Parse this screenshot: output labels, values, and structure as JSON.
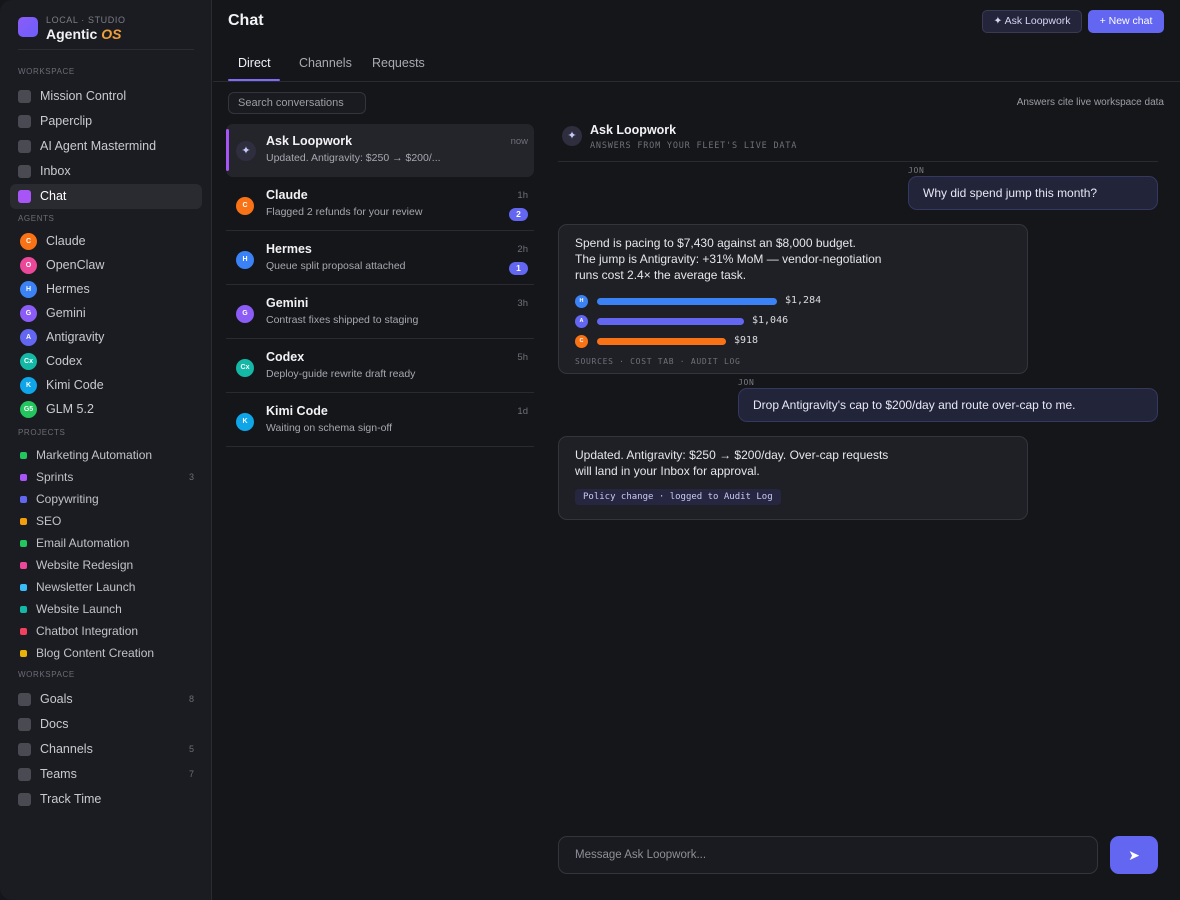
{
  "brand": {
    "sub": "LOCAL · STUDIO",
    "name": "Agentic",
    "name_accent": "OS"
  },
  "sidebar": {
    "workspace_label": "WORKSPACE",
    "workspace": [
      {
        "label": "Mission Control"
      },
      {
        "label": "Paperclip"
      },
      {
        "label": "AI Agent Mastermind"
      },
      {
        "label": "Inbox"
      },
      {
        "label": "Chat",
        "active": true
      }
    ],
    "agents_label": "AGENTS",
    "agents": [
      {
        "label": "Claude",
        "initials": "C",
        "color": "#f97316"
      },
      {
        "label": "OpenClaw",
        "initials": "O",
        "color": "#ec4899"
      },
      {
        "label": "Hermes",
        "initials": "H",
        "color": "#3b82f6"
      },
      {
        "label": "Gemini",
        "initials": "G",
        "color": "#8b5cf6"
      },
      {
        "label": "Antigravity",
        "initials": "A",
        "color": "#6366f1"
      },
      {
        "label": "Codex",
        "initials": "Cx",
        "color": "#14b8a6"
      },
      {
        "label": "Kimi Code",
        "initials": "K",
        "color": "#0ea5e9"
      },
      {
        "label": "GLM 5.2",
        "initials": "G5",
        "color": "#22c55e"
      }
    ],
    "projects_label": "PROJECTS",
    "projects": [
      {
        "label": "Marketing Automation",
        "color": "#22c55e",
        "count": ""
      },
      {
        "label": "Sprints",
        "color": "#a855f7",
        "count": "3"
      },
      {
        "label": "Copywriting",
        "color": "#6366f1",
        "count": ""
      },
      {
        "label": "SEO",
        "color": "#f59e0b",
        "count": ""
      },
      {
        "label": "Email Automation",
        "color": "#22c55e",
        "count": ""
      },
      {
        "label": "Website Redesign",
        "color": "#ec4899",
        "count": ""
      },
      {
        "label": "Newsletter Launch",
        "color": "#38bdf8",
        "count": ""
      },
      {
        "label": "Website Launch",
        "color": "#14b8a6",
        "count": ""
      },
      {
        "label": "Chatbot Integration",
        "color": "#f43f5e",
        "count": ""
      },
      {
        "label": "Blog Content Creation",
        "color": "#eab308",
        "count": ""
      }
    ],
    "workspace2_label": "WORKSPACE",
    "workspace2": [
      {
        "label": "Goals",
        "count": "8"
      },
      {
        "label": "Docs",
        "count": ""
      },
      {
        "label": "Channels",
        "count": "5"
      },
      {
        "label": "Teams",
        "count": "7"
      },
      {
        "label": "Track Time",
        "count": ""
      }
    ]
  },
  "header": {
    "title": "Chat",
    "ask_button": "✦ Ask Loopwork",
    "new_chat_button": "+ New chat"
  },
  "tabs": [
    {
      "label": "Direct",
      "active": true
    },
    {
      "label": "Channels"
    },
    {
      "label": "Requests"
    }
  ],
  "search": {
    "placeholder": "Search conversations"
  },
  "conversations": [
    {
      "name": "Ask Loopwork",
      "preview": "Updated. Antigravity: $250 → $200/...",
      "time": "now",
      "badge": "",
      "icon": "sparkle-icon",
      "active": true
    },
    {
      "name": "Claude",
      "preview": "Flagged 2 refunds for your review",
      "time": "1h",
      "badge": "2",
      "initials": "C",
      "color": "#f97316"
    },
    {
      "name": "Hermes",
      "preview": "Queue split proposal attached",
      "time": "2h",
      "badge": "1",
      "initials": "H",
      "color": "#3b82f6"
    },
    {
      "name": "Gemini",
      "preview": "Contrast fixes shipped to staging",
      "time": "3h",
      "badge": "",
      "initials": "G",
      "color": "#8b5cf6"
    },
    {
      "name": "Codex",
      "preview": "Deploy-guide rewrite draft ready",
      "time": "5h",
      "badge": "",
      "initials": "Cx",
      "color": "#14b8a6"
    },
    {
      "name": "Kimi Code",
      "preview": "Waiting on schema sign-off",
      "time": "1d",
      "badge": "",
      "initials": "K",
      "color": "#0ea5e9"
    }
  ],
  "chat": {
    "cite_note": "Answers cite live workspace data",
    "title": "Ask Loopwork",
    "subtitle": "ANSWERS FROM YOUR FLEET'S LIVE DATA",
    "messages": {
      "user1": {
        "who": "JON",
        "text": "Why did spend jump this month?"
      },
      "bot1": {
        "lines": [
          "Spend is pacing to $7,430 against an $8,000 budget.",
          "The jump is Antigravity: +31% MoM — vendor-negotiation",
          "runs cost 2.4× the average task."
        ],
        "bars": [
          {
            "initials": "H",
            "color": "#3b82f6",
            "value": 1284,
            "label": "$1,284"
          },
          {
            "initials": "A",
            "color": "#6366f1",
            "value": 1046,
            "label": "$1,046"
          },
          {
            "initials": "C",
            "color": "#f97316",
            "value": 918,
            "label": "$918"
          }
        ],
        "bar_max": 1284,
        "sources": "SOURCES · COST TAB · AUDIT LOG"
      },
      "user2": {
        "who": "JON",
        "text": "Drop Antigravity's cap to $200/day and route over-cap to me."
      },
      "bot2": {
        "lines": [
          "Updated. Antigravity: $250 → $200/day. Over-cap requests",
          "will land in your Inbox for approval."
        ],
        "pill": "Policy change · logged to Audit Log"
      }
    },
    "composer_placeholder": "Message Ask Loopwork...",
    "send_icon": "➤"
  }
}
